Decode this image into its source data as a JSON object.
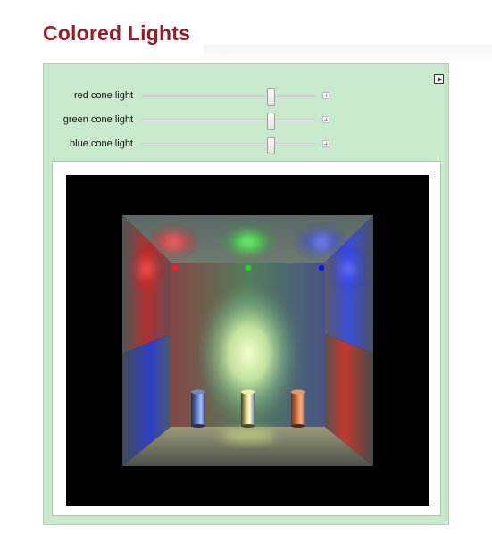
{
  "page": {
    "title": "Colored Lights"
  },
  "controls": [
    {
      "label": "red cone light",
      "value": 0.76
    },
    {
      "label": "green cone light",
      "value": 0.76
    },
    {
      "label": "blue cone light",
      "value": 0.76
    }
  ],
  "scene": {
    "background": "#000000",
    "light_markers": [
      {
        "name": "red",
        "color": "#ff1a1a"
      },
      {
        "name": "green",
        "color": "#14e01b"
      },
      {
        "name": "blue",
        "color": "#1010ff"
      }
    ],
    "cylinders": [
      {
        "name": "blue-cylinder",
        "color": "#5a78c8"
      },
      {
        "name": "yellow-cylinder",
        "color": "#d9d07a"
      },
      {
        "name": "orange-cylinder",
        "color": "#d5733f"
      }
    ]
  }
}
